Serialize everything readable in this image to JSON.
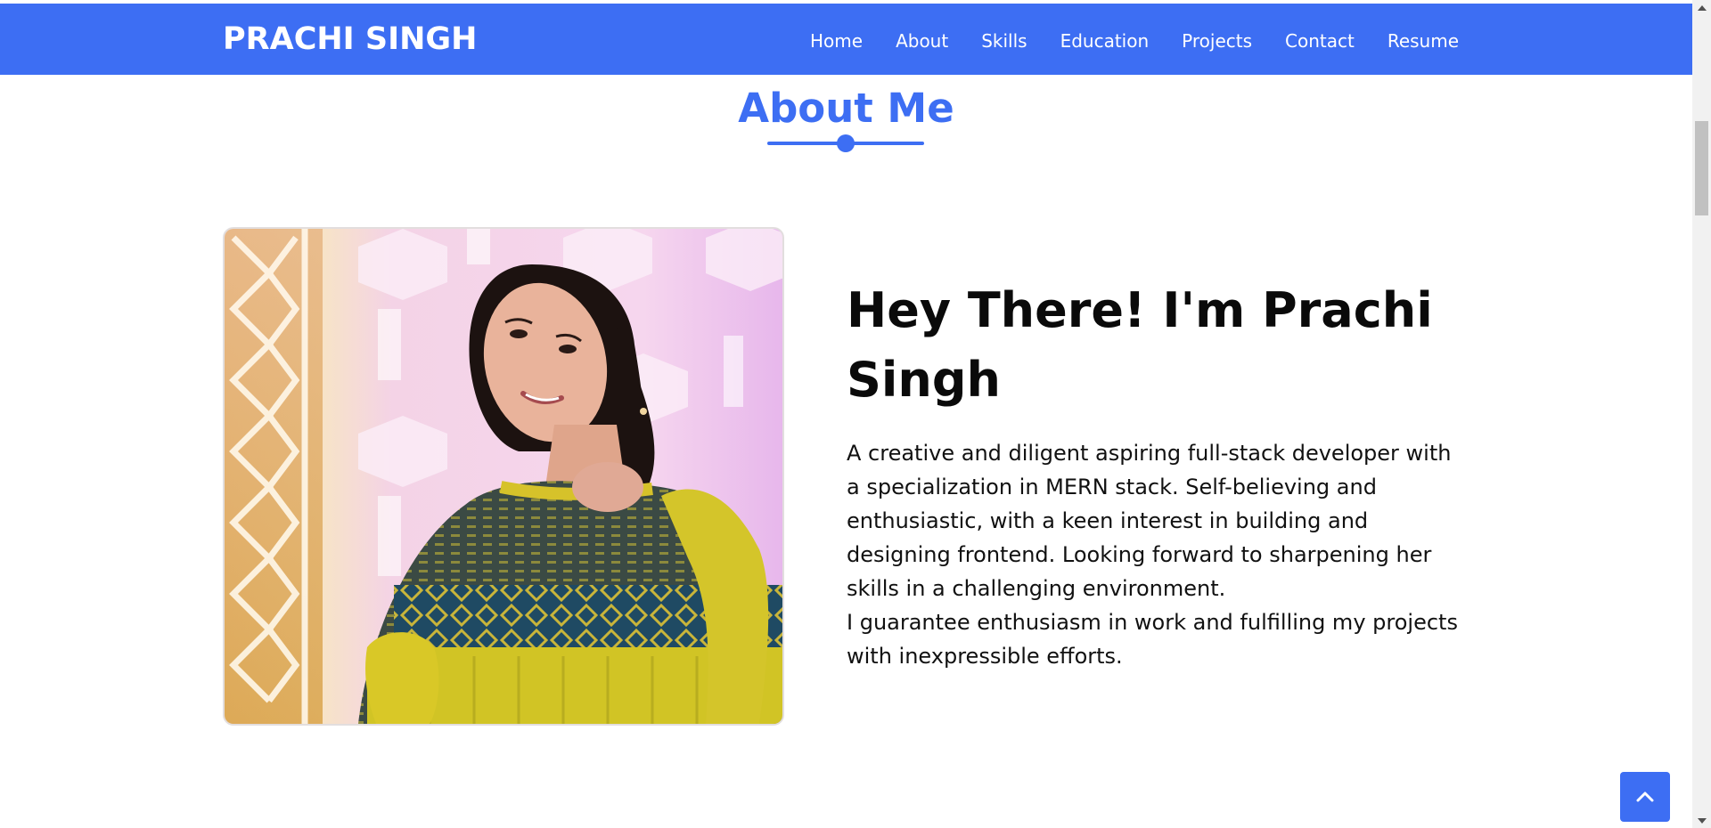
{
  "theme": {
    "accent": "#3d6ef3",
    "heading_color": "#0a0a0a",
    "text_color": "#111111"
  },
  "navbar": {
    "brand": "PRACHI SINGH",
    "links": [
      {
        "label": "Home"
      },
      {
        "label": "About"
      },
      {
        "label": "Skills"
      },
      {
        "label": "Education"
      },
      {
        "label": "Projects"
      },
      {
        "label": "Contact"
      },
      {
        "label": "Resume"
      }
    ]
  },
  "about": {
    "section_title": "About Me",
    "heading": "Hey There! I'm Prachi Singh",
    "paragraphs": [
      "A creative and diligent aspiring full-stack developer with a specialization in MERN stack. Self-believing and enthusiastic, with a keen interest in building and designing frontend. Looking forward to sharpening her skills in a challenging environment.",
      "I guarantee enthusiasm in work and fulfilling my projects with inexpressible efforts."
    ]
  },
  "icons": {
    "scroll_top": "chevron-up-icon"
  }
}
